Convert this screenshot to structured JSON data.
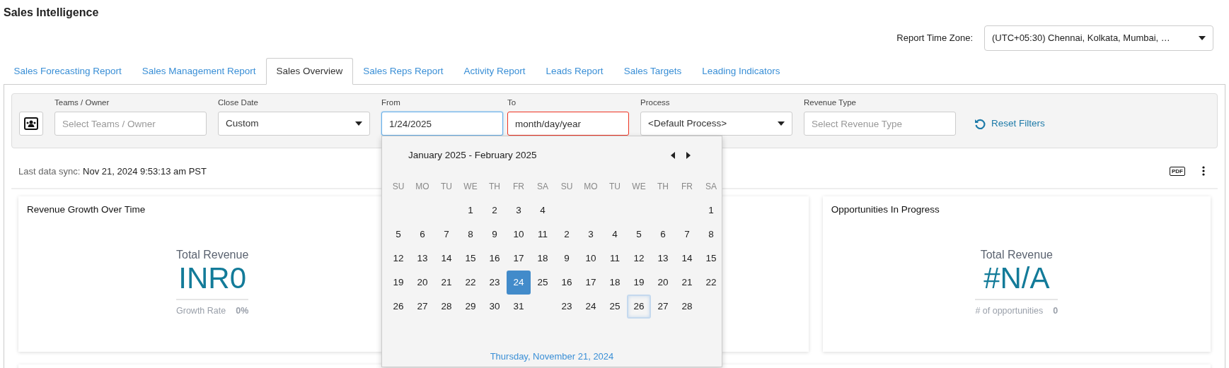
{
  "app_title": "Sales Intelligence",
  "time_zone": {
    "label": "Report Time Zone:",
    "value": "(UTC+05:30) Chennai, Kolkata, Mumbai, …"
  },
  "tabs": [
    {
      "label": "Sales Forecasting Report",
      "selected": false
    },
    {
      "label": "Sales Management Report",
      "selected": false
    },
    {
      "label": "Sales Overview",
      "selected": true
    },
    {
      "label": "Sales Reps Report",
      "selected": false
    },
    {
      "label": "Activity Report",
      "selected": false
    },
    {
      "label": "Leads Report",
      "selected": false
    },
    {
      "label": "Sales Targets",
      "selected": false
    },
    {
      "label": "Leading Indicators",
      "selected": false
    }
  ],
  "filters": [
    {
      "kind": "text",
      "label": "Teams / Owner",
      "placeholder": "Select Teams / Owner"
    },
    {
      "kind": "select",
      "label": "Close Date",
      "value": "Custom"
    },
    {
      "kind": "date",
      "label": "From",
      "value": "1/24/2025",
      "focused": true,
      "invalid": false
    },
    {
      "kind": "date",
      "label": "To",
      "value": "month/day/year",
      "focused": false,
      "invalid": true
    },
    {
      "kind": "select",
      "label": "Process",
      "value": "<Default Process>"
    },
    {
      "kind": "text",
      "label": "Revenue Type",
      "placeholder": "Select Revenue Type"
    }
  ],
  "reset_filters": "Reset Filters",
  "sync": {
    "label": "Last data sync:",
    "value": "Nov 21, 2024 9:53:13 am PST"
  },
  "export_label": "PDF",
  "cards": [
    {
      "kind": "metric",
      "title": "Revenue Growth Over Time",
      "metric_label": "Total Revenue",
      "value": "INR0",
      "foot_label": "Growth Rate",
      "foot_value": "0%"
    },
    {
      "kind": "blank"
    },
    {
      "kind": "metric",
      "title": "Opportunities In Progress",
      "metric_label": "Total Revenue",
      "value": "#N/A",
      "foot_label": "# of opportunities",
      "foot_value": "0"
    }
  ],
  "calendar": {
    "header": "January 2025 - February 2025",
    "weekdays": [
      "SU",
      "MO",
      "TU",
      "WE",
      "TH",
      "FR",
      "SA",
      "SU",
      "MO",
      "TU",
      "WE",
      "TH",
      "FR",
      "SA"
    ],
    "weeks": [
      [
        {
          "kind": "blank"
        },
        {
          "kind": "blank"
        },
        {
          "kind": "blank"
        },
        {
          "kind": "day",
          "label": "1",
          "selected": false,
          "focused": false
        },
        {
          "kind": "day",
          "label": "2",
          "selected": false,
          "focused": false
        },
        {
          "kind": "day",
          "label": "3",
          "selected": false,
          "focused": false
        },
        {
          "kind": "day",
          "label": "4",
          "selected": false,
          "focused": false
        },
        {
          "kind": "blank"
        },
        {
          "kind": "blank"
        },
        {
          "kind": "blank"
        },
        {
          "kind": "blank"
        },
        {
          "kind": "blank"
        },
        {
          "kind": "blank"
        },
        {
          "kind": "day",
          "label": "1",
          "selected": false,
          "focused": false
        }
      ],
      [
        {
          "kind": "day",
          "label": "5",
          "selected": false,
          "focused": false
        },
        {
          "kind": "day",
          "label": "6",
          "selected": false,
          "focused": false
        },
        {
          "kind": "day",
          "label": "7",
          "selected": false,
          "focused": false
        },
        {
          "kind": "day",
          "label": "8",
          "selected": false,
          "focused": false
        },
        {
          "kind": "day",
          "label": "9",
          "selected": false,
          "focused": false
        },
        {
          "kind": "day",
          "label": "10",
          "selected": false,
          "focused": false
        },
        {
          "kind": "day",
          "label": "11",
          "selected": false,
          "focused": false
        },
        {
          "kind": "day",
          "label": "2",
          "selected": false,
          "focused": false
        },
        {
          "kind": "day",
          "label": "3",
          "selected": false,
          "focused": false
        },
        {
          "kind": "day",
          "label": "4",
          "selected": false,
          "focused": false
        },
        {
          "kind": "day",
          "label": "5",
          "selected": false,
          "focused": false
        },
        {
          "kind": "day",
          "label": "6",
          "selected": false,
          "focused": false
        },
        {
          "kind": "day",
          "label": "7",
          "selected": false,
          "focused": false
        },
        {
          "kind": "day",
          "label": "8",
          "selected": false,
          "focused": false
        }
      ],
      [
        {
          "kind": "day",
          "label": "12",
          "selected": false,
          "focused": false
        },
        {
          "kind": "day",
          "label": "13",
          "selected": false,
          "focused": false
        },
        {
          "kind": "day",
          "label": "14",
          "selected": false,
          "focused": false
        },
        {
          "kind": "day",
          "label": "15",
          "selected": false,
          "focused": false
        },
        {
          "kind": "day",
          "label": "16",
          "selected": false,
          "focused": false
        },
        {
          "kind": "day",
          "label": "17",
          "selected": false,
          "focused": false
        },
        {
          "kind": "day",
          "label": "18",
          "selected": false,
          "focused": false
        },
        {
          "kind": "day",
          "label": "9",
          "selected": false,
          "focused": false
        },
        {
          "kind": "day",
          "label": "10",
          "selected": false,
          "focused": false
        },
        {
          "kind": "day",
          "label": "11",
          "selected": false,
          "focused": false
        },
        {
          "kind": "day",
          "label": "12",
          "selected": false,
          "focused": false
        },
        {
          "kind": "day",
          "label": "13",
          "selected": false,
          "focused": false
        },
        {
          "kind": "day",
          "label": "14",
          "selected": false,
          "focused": false
        },
        {
          "kind": "day",
          "label": "15",
          "selected": false,
          "focused": false
        }
      ],
      [
        {
          "kind": "day",
          "label": "19",
          "selected": false,
          "focused": false
        },
        {
          "kind": "day",
          "label": "20",
          "selected": false,
          "focused": false
        },
        {
          "kind": "day",
          "label": "21",
          "selected": false,
          "focused": false
        },
        {
          "kind": "day",
          "label": "22",
          "selected": false,
          "focused": false
        },
        {
          "kind": "day",
          "label": "23",
          "selected": false,
          "focused": false
        },
        {
          "kind": "day",
          "label": "24",
          "selected": true,
          "focused": false
        },
        {
          "kind": "day",
          "label": "25",
          "selected": false,
          "focused": false
        },
        {
          "kind": "day",
          "label": "16",
          "selected": false,
          "focused": false
        },
        {
          "kind": "day",
          "label": "17",
          "selected": false,
          "focused": false
        },
        {
          "kind": "day",
          "label": "18",
          "selected": false,
          "focused": false
        },
        {
          "kind": "day",
          "label": "19",
          "selected": false,
          "focused": false
        },
        {
          "kind": "day",
          "label": "20",
          "selected": false,
          "focused": false
        },
        {
          "kind": "day",
          "label": "21",
          "selected": false,
          "focused": false
        },
        {
          "kind": "day",
          "label": "22",
          "selected": false,
          "focused": false
        }
      ],
      [
        {
          "kind": "day",
          "label": "26",
          "selected": false,
          "focused": false
        },
        {
          "kind": "day",
          "label": "27",
          "selected": false,
          "focused": false
        },
        {
          "kind": "day",
          "label": "28",
          "selected": false,
          "focused": false
        },
        {
          "kind": "day",
          "label": "29",
          "selected": false,
          "focused": false
        },
        {
          "kind": "day",
          "label": "30",
          "selected": false,
          "focused": false
        },
        {
          "kind": "day",
          "label": "31",
          "selected": false,
          "focused": false
        },
        {
          "kind": "blank"
        },
        {
          "kind": "day",
          "label": "23",
          "selected": false,
          "focused": false
        },
        {
          "kind": "day",
          "label": "24",
          "selected": false,
          "focused": false
        },
        {
          "kind": "day",
          "label": "25",
          "selected": false,
          "focused": false
        },
        {
          "kind": "day",
          "label": "26",
          "selected": false,
          "focused": true
        },
        {
          "kind": "day",
          "label": "27",
          "selected": false,
          "focused": false
        },
        {
          "kind": "day",
          "label": "28",
          "selected": false,
          "focused": false
        },
        {
          "kind": "blank"
        }
      ]
    ],
    "today": "Thursday, November 21, 2024"
  }
}
